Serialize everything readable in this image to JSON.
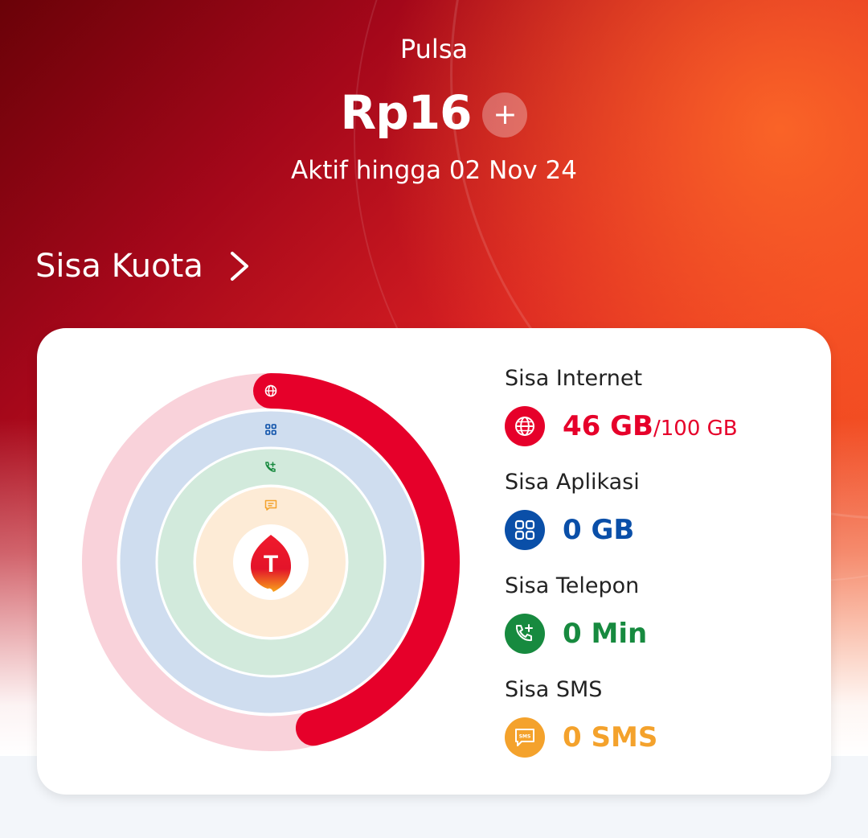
{
  "header": {
    "pulsa_label": "Pulsa",
    "balance": "Rp16",
    "topup_symbol": "+",
    "active_until": "Aktif hingga 02 Nov 24"
  },
  "quota": {
    "title": "Sisa Kuota",
    "internet": {
      "label": "Sisa Internet",
      "value": "46 GB",
      "total": "/100 GB",
      "used_fraction": 0.46,
      "color": "#e6002a",
      "track_color": "#f9d2da",
      "icon": "globe-icon"
    },
    "aplikasi": {
      "label": "Sisa Aplikasi",
      "value": "0 GB",
      "color": "#0a4fa8",
      "track_color": "#cfddef",
      "icon": "apps-grid-icon"
    },
    "telepon": {
      "label": "Sisa Telepon",
      "value": "0 Min",
      "color": "#178a3f",
      "track_color": "#d2eadc",
      "icon": "phone-plus-icon"
    },
    "sms": {
      "label": "Sisa SMS",
      "value": "0 SMS",
      "color": "#f4a22c",
      "track_color": "#fdebd6",
      "icon": "sms-bubble-icon"
    }
  },
  "logo": {
    "letter": "T"
  }
}
